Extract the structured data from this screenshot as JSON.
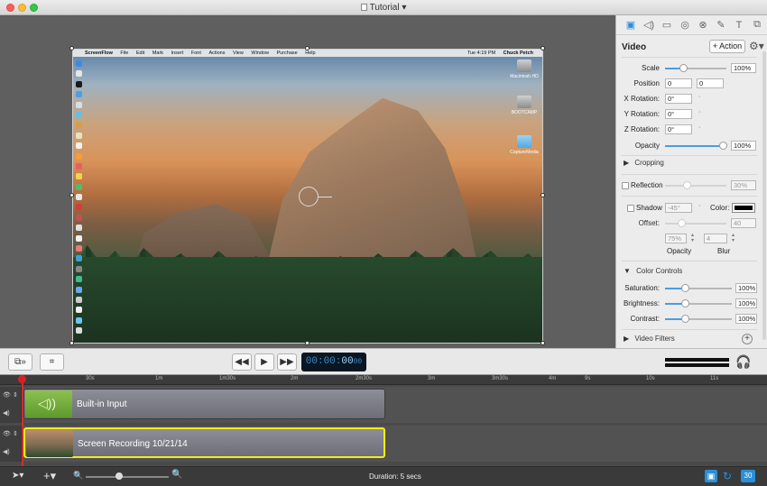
{
  "window": {
    "title": "Tutorial"
  },
  "canvas": {
    "mac_menu": {
      "app": "ScreenFlow",
      "items": [
        "File",
        "Edit",
        "Mark",
        "Insert",
        "Font",
        "Actions",
        "View",
        "Window",
        "Purchase",
        "Help"
      ],
      "clock": "Tue 4:19 PM",
      "user": "Chuck Petch"
    },
    "desktop_icons": [
      "Macintosh HD",
      "BOOTCAMP",
      "CaptureMedia"
    ]
  },
  "inspector": {
    "section_title": "Video",
    "action_label": "+ Action",
    "scale_label": "Scale",
    "scale_value": "100%",
    "position_label": "Position",
    "position_x": "0",
    "position_y": "0",
    "x_rotation_label": "X Rotation:",
    "x_rotation_value": "0°",
    "y_rotation_label": "Y Rotation:",
    "y_rotation_value": "0°",
    "z_rotation_label": "Z Rotation:",
    "z_rotation_value": "0°",
    "opacity_label": "Opacity",
    "opacity_value": "100%",
    "cropping_label": "Cropping",
    "reflection_label": "Reflection",
    "reflection_value": "30%",
    "shadow_label": "Shadow",
    "shadow_angle": "-45°",
    "color_label": "Color:",
    "offset_label": "Offset:",
    "offset_value": "40",
    "shadow_opacity_value": "75%",
    "shadow_blur_value": "4",
    "shadow_opacity_label": "Opacity",
    "shadow_blur_label": "Blur",
    "color_controls_label": "Color Controls",
    "saturation_label": "Saturation:",
    "saturation_value": "100%",
    "brightness_label": "Brightness:",
    "brightness_value": "100%",
    "contrast_label": "Contrast:",
    "contrast_value": "100%",
    "video_filters_label": "Video Filters"
  },
  "transport": {
    "timecode_dim": "00:00:",
    "timecode_bright": "00",
    "timecode_frames": "00"
  },
  "ruler": {
    "ticks": [
      "30s",
      "1m",
      "1m30s",
      "2m",
      "2m30s",
      "3m",
      "3m30s",
      "4m",
      "9s",
      "10s",
      "11s"
    ]
  },
  "tracks": {
    "audio_clip_label": "Built-in Input",
    "video_clip_label": "Screen Recording 10/21/14"
  },
  "footer": {
    "duration": "Duration: 5 secs",
    "badge": "30"
  },
  "colors": {
    "accent": "#2a8fd8",
    "playhead": "#d12d2d",
    "selection": "#f2ee1c"
  }
}
